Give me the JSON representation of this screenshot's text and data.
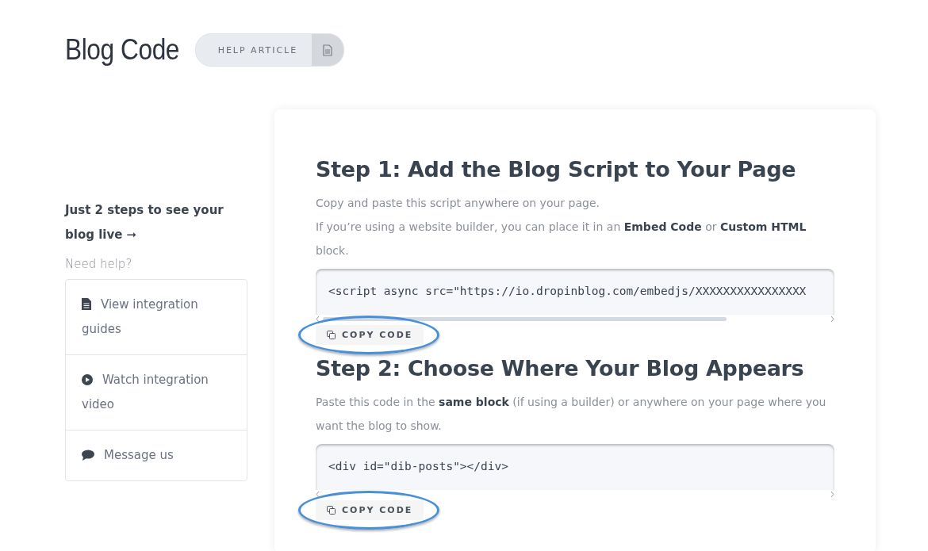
{
  "header": {
    "title": "Blog Code",
    "badge": {
      "label": "HELP ARTICLE"
    }
  },
  "sidebar": {
    "intro": "Just 2 steps to see your blog live ➞",
    "help_heading": "Need help?",
    "links": [
      {
        "kind": "guide",
        "label": "View integration guides"
      },
      {
        "kind": "video",
        "label": "Watch integration video"
      },
      {
        "kind": "message",
        "label": "Message us"
      }
    ]
  },
  "steps": [
    {
      "title": "Step 1: Add the Blog Script to Your Page",
      "paragraphs": [
        "Copy and paste this script anywhere on your page.",
        "If you’re using a website builder, you can place it in an **Embed Code** or **Custom HTML** block."
      ],
      "code": "<script async src=\"https://io.dropinblog.com/embedjs/XXXXXXXXXXXXXXXX",
      "copy_button": {
        "label": "COPY CODE",
        "highlighted": true
      }
    },
    {
      "title": "Step 2: Choose Where Your Blog Appears",
      "paragraphs": [
        "Paste this code in the **same block** (if using a builder) or anywhere on your page where you want the blog to show."
      ],
      "code": "<div id=\"dib-posts\"></div>",
      "copy_button": {
        "label": "COPY CODE",
        "highlighted": true
      }
    }
  ]
}
